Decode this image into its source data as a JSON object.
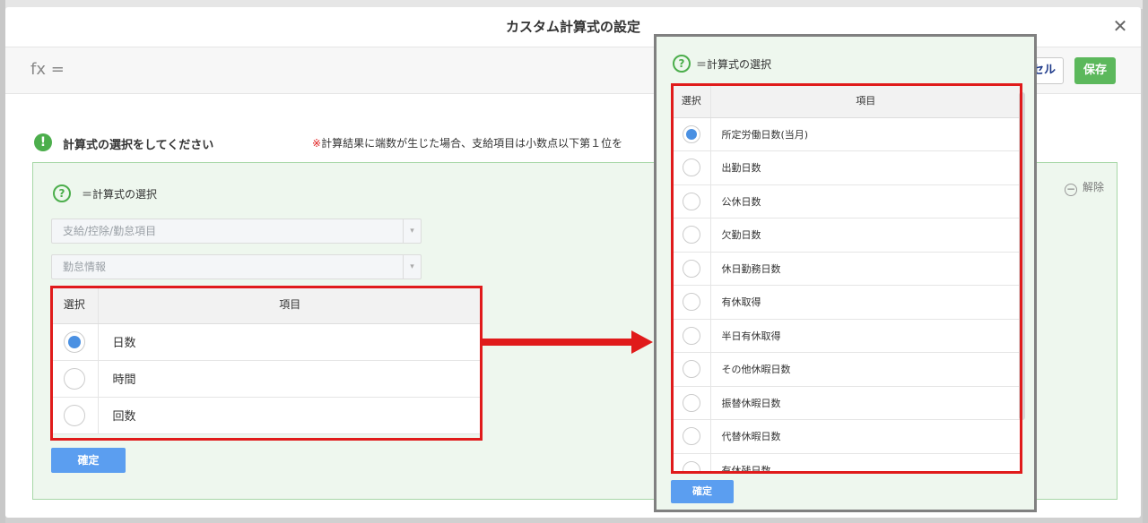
{
  "modal": {
    "title": "カスタム計算式の設定",
    "fx_label": "fx =",
    "cancel_label": "セル",
    "save_label": "保存"
  },
  "instruction": {
    "title": "計算式の選択をしてください",
    "note_mark": "※",
    "note_text": "計算結果に端数が生じた場合、支給項目は小数点以下第１位を"
  },
  "selector": {
    "formula_label": "＝計算式の選択",
    "unset_label": "解除",
    "select1_placeholder": "支給/控除/勤怠項目",
    "select2_value": "勤怠情報",
    "table": {
      "col_select": "選択",
      "col_item": "項目",
      "rows": [
        {
          "label": "日数",
          "selected": true
        },
        {
          "label": "時間",
          "selected": false
        },
        {
          "label": "回数",
          "selected": false
        }
      ]
    },
    "confirm_label": "確定"
  },
  "detail_panel": {
    "formula_label": "＝計算式の選択",
    "table": {
      "col_select": "選択",
      "col_item": "項目",
      "rows": [
        {
          "label": "所定労働日数(当月)",
          "selected": true
        },
        {
          "label": "出勤日数",
          "selected": false
        },
        {
          "label": "公休日数",
          "selected": false
        },
        {
          "label": "欠勤日数",
          "selected": false
        },
        {
          "label": "休日勤務日数",
          "selected": false
        },
        {
          "label": "有休取得",
          "selected": false
        },
        {
          "label": "半日有休取得",
          "selected": false
        },
        {
          "label": "その他休暇日数",
          "selected": false
        },
        {
          "label": "振替休暇日数",
          "selected": false
        },
        {
          "label": "代替休暇日数",
          "selected": false
        },
        {
          "label": "有休残日数",
          "selected": false
        }
      ]
    },
    "confirm_label": "確定"
  },
  "colors": {
    "highlight": "#e01b1b",
    "accent_blue": "#4a90e2",
    "save_green": "#5cb85c"
  }
}
